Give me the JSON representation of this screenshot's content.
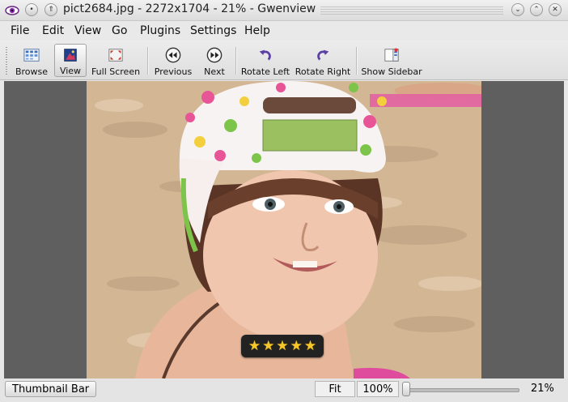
{
  "window": {
    "title": "pict2684.jpg - 2272x1704 - 21% - Gwenview"
  },
  "menubar": {
    "items": [
      "File",
      "Edit",
      "View",
      "Go",
      "Plugins",
      "Settings",
      "Help"
    ]
  },
  "toolbar": {
    "browse": "Browse",
    "view": "View",
    "full_screen": "Full Screen",
    "previous": "Previous",
    "next": "Next",
    "rotate_left": "Rotate Left",
    "rotate_right": "Rotate Right",
    "show_sidebar": "Show Sidebar"
  },
  "rating": {
    "stars": 5,
    "max": 5
  },
  "statusbar": {
    "thumbnail_bar": "Thumbnail Bar",
    "fit": "Fit",
    "zoom_100": "100%",
    "zoom_value": 0.21,
    "zoom_label": "21%"
  },
  "colors": {
    "viewer_background": "#5f5f5f",
    "star": "#f6c62a"
  }
}
